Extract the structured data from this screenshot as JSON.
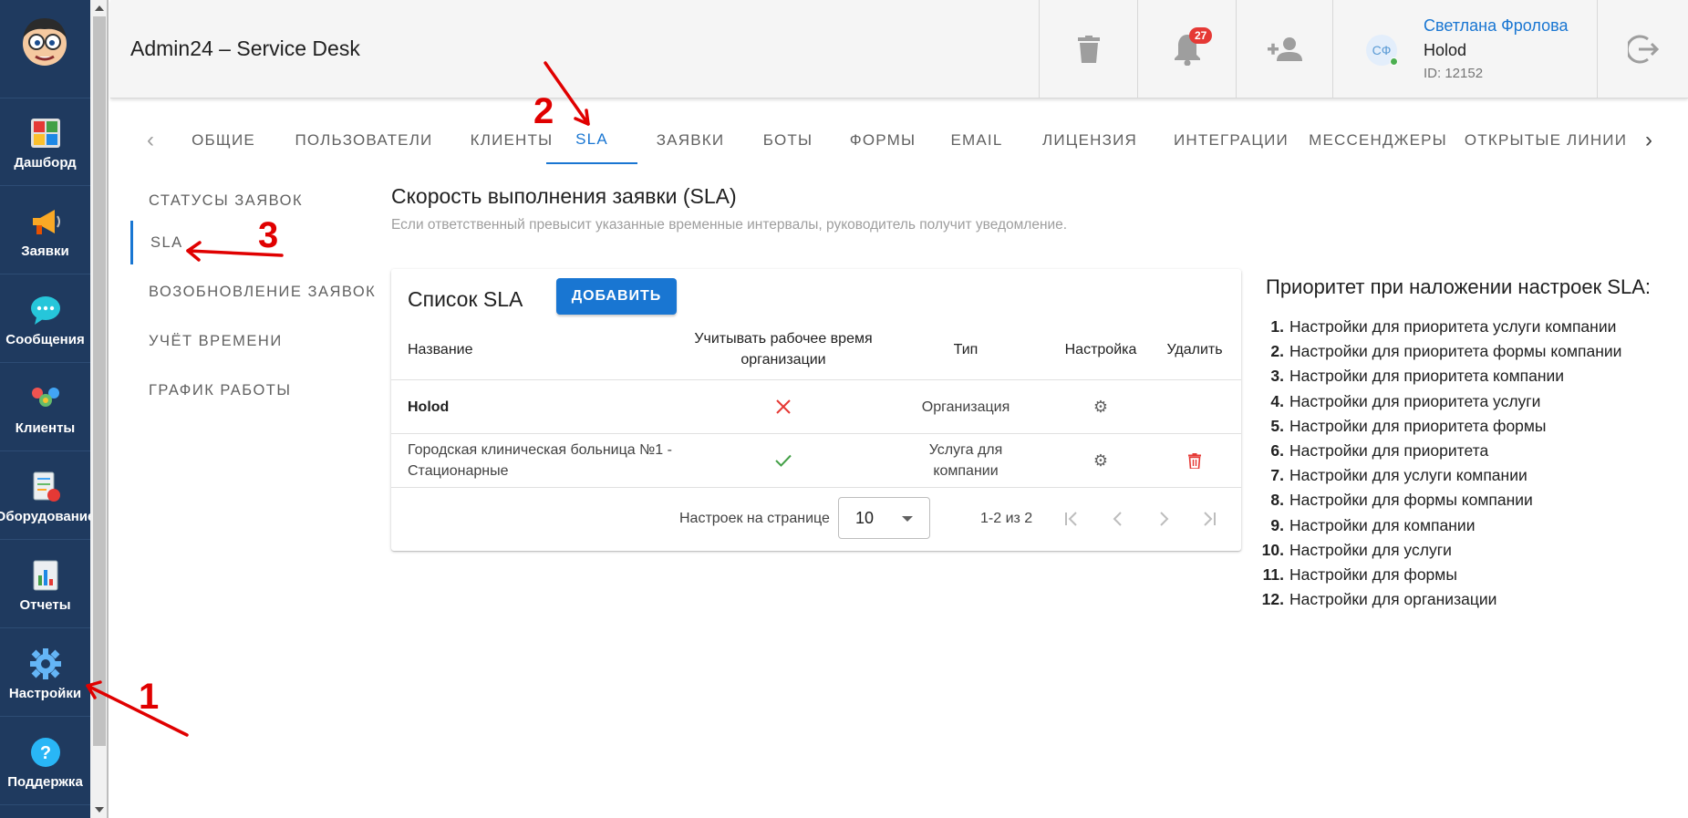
{
  "app": {
    "title": "Admin24 – Service Desk"
  },
  "sidebar": {
    "items": [
      {
        "label": "Дашборд",
        "icon": "dashboard-icon"
      },
      {
        "label": "Заявки",
        "icon": "megaphone-icon"
      },
      {
        "label": "Сообщения",
        "icon": "chat-icon"
      },
      {
        "label": "Клиенты",
        "icon": "clients-icon"
      },
      {
        "label": "Оборудование",
        "icon": "equipment-icon"
      },
      {
        "label": "Отчеты",
        "icon": "reports-icon"
      },
      {
        "label": "Настройки",
        "icon": "gear-icon"
      },
      {
        "label": "Поддержка",
        "icon": "help-icon"
      }
    ]
  },
  "header": {
    "notifications_count": "27",
    "user": {
      "initials": "СФ",
      "name": "Светлана Фролова",
      "org": "Holod",
      "id": "ID: 12152"
    }
  },
  "tabs": [
    "ОБЩИЕ",
    "ПОЛЬЗОВАТЕЛИ",
    "КЛИЕНТЫ",
    "SLA",
    "ЗАЯВКИ",
    "БОТЫ",
    "ФОРМЫ",
    "EMAIL",
    "ЛИЦЕНЗИЯ",
    "ИНТЕГРАЦИИ",
    "МЕССЕНДЖЕРЫ",
    "ОТКРЫТЫЕ ЛИНИИ"
  ],
  "active_tab": "SLA",
  "subnav": [
    "СТАТУСЫ ЗАЯВОК",
    "SLA",
    "ВОЗОБНОВЛЕНИЕ ЗАЯВОК",
    "УЧЁТ ВРЕМЕНИ",
    "ГРАФИК РАБОТЫ"
  ],
  "sla": {
    "title": "Скорость выполнения заявки (SLA)",
    "description": "Если ответственный превысит указанные временные интервалы, руководитель получит уведомление.",
    "list_title": "Список SLA",
    "add_button": "ДОБАВИТЬ",
    "columns": [
      "Название",
      "Учитывать рабочее время организации",
      "Тип",
      "Настройка",
      "Удалить"
    ],
    "rows": [
      {
        "name": "Holod",
        "work_time": false,
        "type": "Организация",
        "deletable": false
      },
      {
        "name": "Городская клиническая больница №1 - Стационарные",
        "work_time": true,
        "type": "Услуга для компании",
        "deletable": true
      }
    ],
    "per_page_label": "Настроек на странице",
    "per_page": "10",
    "range": "1-2 из 2"
  },
  "priority": {
    "title": "Приоритет при наложении настроек SLA:",
    "items": [
      "Настройки для приоритета услуги компании",
      "Настройки для приоритета формы компании",
      "Настройки для приоритета компании",
      "Настройки для приоритета услуги",
      "Настройки для приоритета формы",
      "Настройки для приоритета",
      "Настройки для услуги компании",
      "Настройки для формы компании",
      "Настройки для компании",
      "Настройки для услуги",
      "Настройки для формы",
      "Настройки для организации"
    ]
  },
  "annotations": [
    "1",
    "2",
    "3"
  ],
  "colors": {
    "accent": "#1976d2",
    "sidebar": "#1f3a5f",
    "danger": "#e53935",
    "success": "#43a047",
    "annotation": "#e00000"
  }
}
